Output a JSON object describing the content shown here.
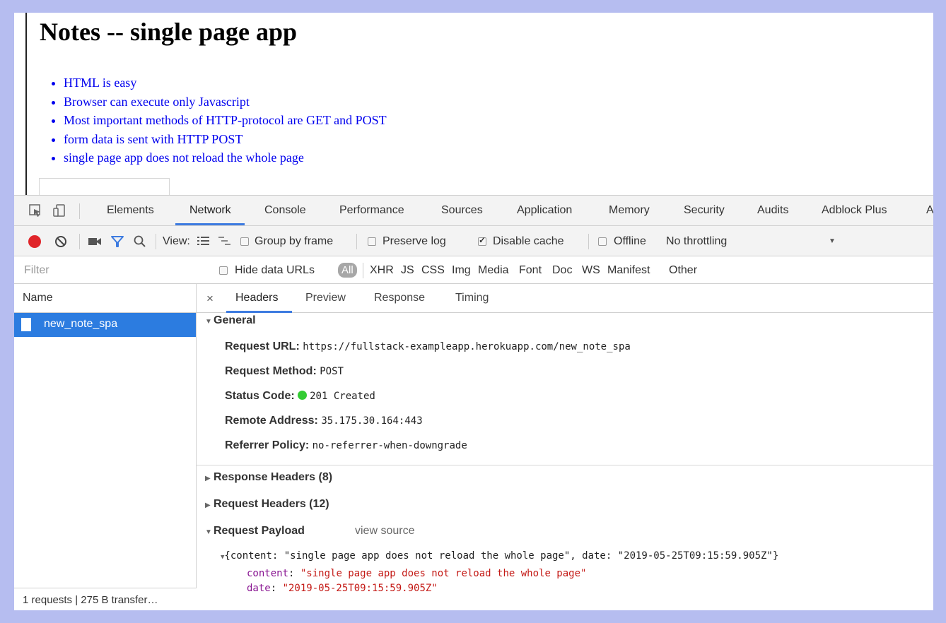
{
  "page": {
    "title": "Notes -- single page app",
    "notes": [
      "HTML is easy",
      "Browser can execute only Javascript",
      "Most important methods of HTTP-protocol are GET and POST",
      "form data is sent with HTTP POST",
      "single page app does not reload the whole page"
    ],
    "input_value": ""
  },
  "devtools": {
    "tabs": [
      "Elements",
      "Network",
      "Console",
      "Performance",
      "Sources",
      "Application",
      "Memory",
      "Security",
      "Audits",
      "Adblock Plus",
      "A"
    ],
    "active_tab": "Network",
    "toolbar": {
      "view_label": "View:",
      "group_by_frame": "Group by frame",
      "preserve_log": "Preserve log",
      "disable_cache": "Disable cache",
      "offline": "Offline",
      "throttling": "No throttling",
      "dropdown_glyph": "▼"
    },
    "filterbar": {
      "placeholder": "Filter",
      "hide_data_urls": "Hide data URLs",
      "types": [
        "All",
        "XHR",
        "JS",
        "CSS",
        "Img",
        "Media",
        "Font",
        "Doc",
        "WS",
        "Manifest",
        "Other"
      ]
    },
    "name_pane": {
      "header": "Name",
      "requests": [
        "new_note_spa"
      ],
      "status": "1 requests | 275 B transfer…"
    },
    "detail": {
      "close_glyph": "×",
      "tabs": [
        "Headers",
        "Preview",
        "Response",
        "Timing"
      ],
      "general_title": "General",
      "general": [
        {
          "key": "Request URL:",
          "value": "https://fullstack-exampleapp.herokuapp.com/new_note_spa"
        },
        {
          "key": "Request Method:",
          "value": "POST"
        },
        {
          "key": "Status Code:",
          "value": "201 Created"
        },
        {
          "key": "Remote Address:",
          "value": "35.175.30.164:443"
        },
        {
          "key": "Referrer Policy:",
          "value": "no-referrer-when-downgrade"
        }
      ],
      "response_headers": "Response Headers (8)",
      "request_headers": "Request Headers (12)",
      "request_payload": "Request Payload",
      "view_source": "view source",
      "payload_summary": "{content: \"single page app does not reload the whole page\", date: \"2019-05-25T09:15:59.905Z\"}",
      "payload_fields": [
        {
          "key": "content",
          "value": "\"single page app does not reload the whole page\""
        },
        {
          "key": "date",
          "value": "\"2019-05-25T09:15:59.905Z\""
        }
      ]
    },
    "colors": {
      "record": "#e0252a",
      "selected_row": "#2c7ce0",
      "status_ok": "#33cc33",
      "accent": "#3d7be0"
    }
  }
}
